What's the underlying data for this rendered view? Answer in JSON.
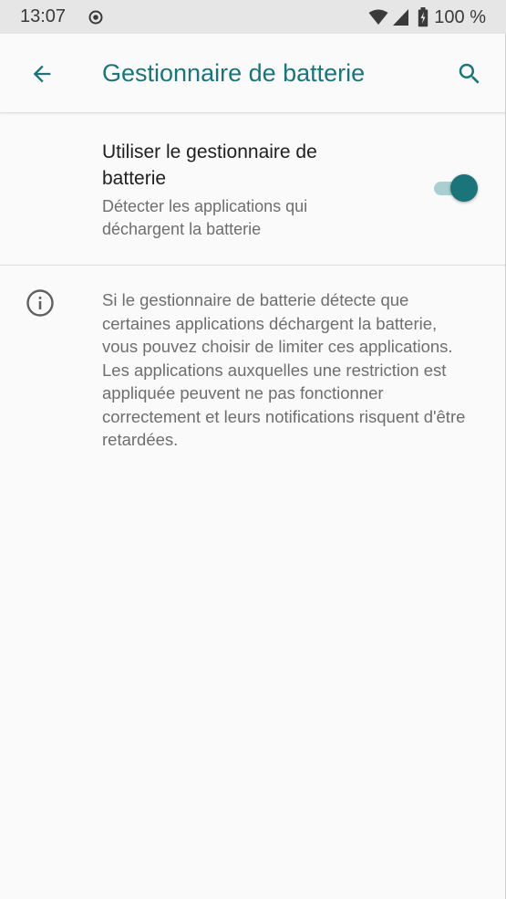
{
  "status_bar": {
    "time": "13:07",
    "battery_percent": "100 %",
    "icons": [
      "sync-icon",
      "wifi-icon",
      "cell-signal-icon",
      "battery-icon"
    ]
  },
  "app_bar": {
    "title": "Gestionnaire de batterie",
    "back_icon": "arrow-left-icon",
    "search_icon": "search-icon"
  },
  "battery_manager_setting": {
    "title": "Utiliser le gestionnaire de batterie",
    "summary": "Détecter les applications qui déchargent la batterie",
    "enabled": true
  },
  "info": {
    "icon": "info-icon",
    "text": "Si le gestionnaire de batterie détecte que certaines applications déchargent la batterie, vous pouvez choisir de limiter ces applications. Les applications auxquelles une restriction est appliquée peuvent ne pas fonctionner correctement et leurs notifications risquent d'être retardées."
  },
  "colors": {
    "accent": "#1b7479",
    "toggle_track": "#a9cfd0",
    "status_bar_bg": "#e6e6e6",
    "background": "#fafafa"
  }
}
